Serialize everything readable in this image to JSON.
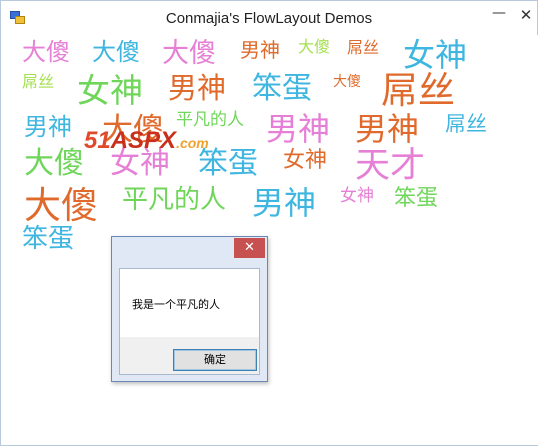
{
  "window": {
    "title": "Conmajia's FlowLayout Demos",
    "minimize_label": "—",
    "close_label": "✕"
  },
  "words": [
    {
      "text": "大傻",
      "color": "#e67fd6"
    },
    {
      "text": "大傻",
      "color": "#3fb6e0"
    },
    {
      "text": "大傻",
      "color": "#e67fd6"
    },
    {
      "text": "男神",
      "color": "#e06a2b"
    },
    {
      "text": "大傻",
      "color": "#a6e052"
    },
    {
      "text": "屌丝",
      "color": "#e06a2b"
    },
    {
      "text": "女神",
      "color": "#3fb6e0"
    },
    {
      "text": "屌丝",
      "color": "#a6e052"
    },
    {
      "text": "女神",
      "color": "#6fd65a"
    },
    {
      "text": "男神",
      "color": "#e06a2b"
    },
    {
      "text": "笨蛋",
      "color": "#3fb6e0"
    },
    {
      "text": "大傻",
      "color": "#e06a2b"
    },
    {
      "text": "屌丝",
      "color": "#e06a2b"
    },
    {
      "text": "男神",
      "color": "#3fb6e0"
    },
    {
      "text": "大傻",
      "color": "#e06a2b"
    },
    {
      "text": "平凡的人",
      "color": "#6fd65a"
    },
    {
      "text": "男神",
      "color": "#e67fd6"
    },
    {
      "text": "男神",
      "color": "#e06a2b"
    },
    {
      "text": "屌丝",
      "color": "#3fb6e0"
    },
    {
      "text": "大傻",
      "color": "#6fd65a"
    },
    {
      "text": "女神",
      "color": "#e67fd6"
    },
    {
      "text": "笨蛋",
      "color": "#3fb6e0"
    },
    {
      "text": "女神",
      "color": "#e06a2b"
    },
    {
      "text": "天才",
      "color": "#e67fd6"
    },
    {
      "text": "大傻",
      "color": "#e06a2b"
    },
    {
      "text": "平凡的人",
      "color": "#6fd65a"
    },
    {
      "text": "男神",
      "color": "#3fb6e0"
    },
    {
      "text": "女神",
      "color": "#e67fd6"
    },
    {
      "text": "笨蛋",
      "color": "#6fd65a"
    },
    {
      "text": "笨蛋",
      "color": "#3fb6e0"
    }
  ],
  "watermark": {
    "part1": "51",
    "part2": "ASPX",
    "part3": ".com"
  },
  "dialog": {
    "close_label": "✕",
    "message": "我是一个平凡的人",
    "ok_label": "确定"
  }
}
